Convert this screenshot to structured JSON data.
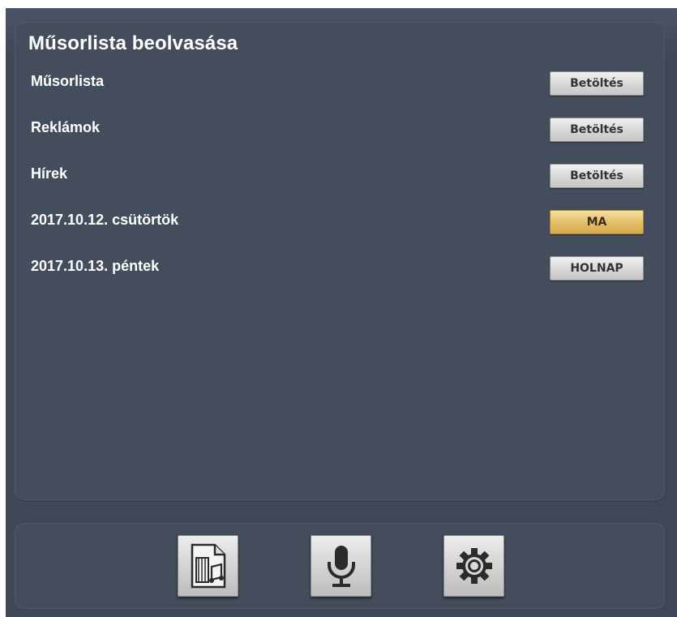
{
  "panel": {
    "title": "Műsorlista beolvasása",
    "rows": [
      {
        "label": "Műsorlista",
        "button": "Betöltés",
        "active": false
      },
      {
        "label": "Reklámok",
        "button": "Betöltés",
        "active": false
      },
      {
        "label": "Hírek",
        "button": "Betöltés",
        "active": false
      },
      {
        "label": "2017.10.12. csütörtök",
        "button": "MA",
        "active": true
      },
      {
        "label": "2017.10.13. péntek",
        "button": "HOLNAP",
        "active": false
      }
    ]
  },
  "toolbar": {
    "buttons": [
      {
        "icon": "playlist-document-icon"
      },
      {
        "icon": "microphone-icon"
      },
      {
        "icon": "gear-icon"
      }
    ]
  },
  "colors": {
    "background": "#3f4757",
    "panel": "#444d5c",
    "button_face": "#d6d6d6",
    "button_active": "#e3bd66"
  }
}
